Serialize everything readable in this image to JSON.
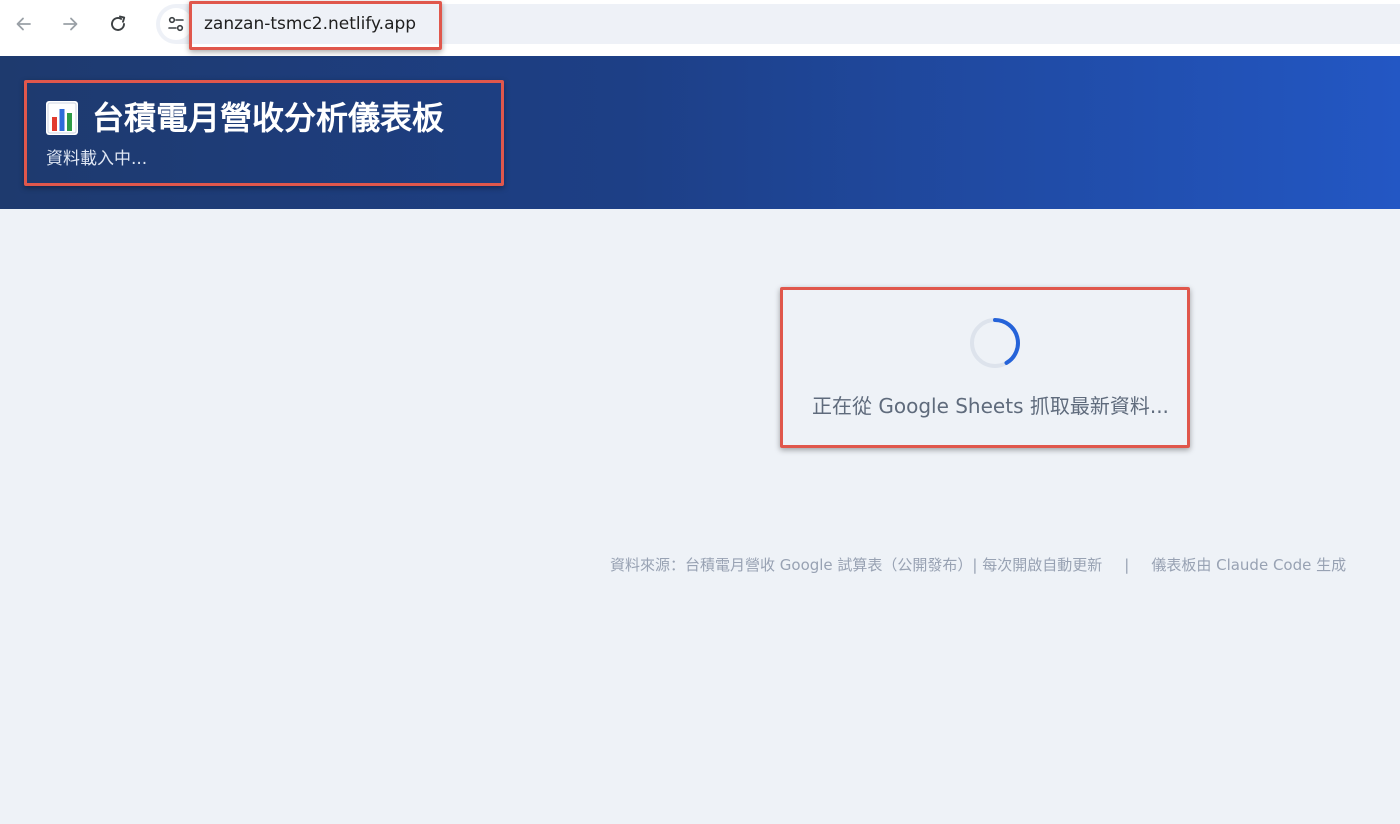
{
  "browser": {
    "url": "zanzan-tsmc2.netlify.app",
    "back_icon": "arrow-left-icon",
    "forward_icon": "arrow-right-icon",
    "reload_icon": "reload-icon",
    "site_info_icon": "tune-icon"
  },
  "header": {
    "icon": "bar-chart-icon",
    "title": "台積電月營收分析儀表板",
    "subtitle": "資料載入中..."
  },
  "loading": {
    "message": "正在從 Google Sheets 抓取最新資料..."
  },
  "footer": {
    "source_text": "資料來源：台積電月營收 Google 試算表（公開發布）| 每次開啟自動更新",
    "separator": "|",
    "credit_text": "儀表板由 Claude Code 生成"
  },
  "colors": {
    "banner_start": "#1e3a6e",
    "banner_end": "#2357c4",
    "page_background": "#eef2f7",
    "spinner_accent": "#2563d9",
    "annotation_box": "#e0574c"
  }
}
